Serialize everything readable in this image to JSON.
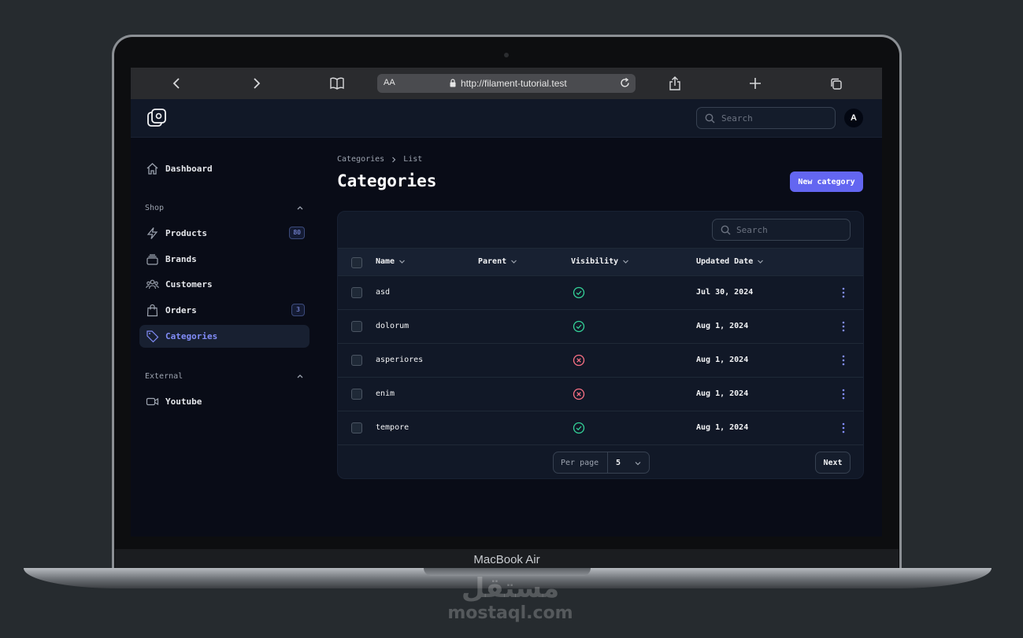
{
  "browser": {
    "aa_label": "AA",
    "url": "http://filament-tutorial.test"
  },
  "topbar": {
    "search_placeholder": "Search",
    "avatar_initial": "A"
  },
  "sidebar": {
    "dashboard": "Dashboard",
    "groups": {
      "shop": "Shop",
      "external": "External"
    },
    "items": [
      {
        "label": "Products",
        "icon": "bolt-icon",
        "badge": "80"
      },
      {
        "label": "Brands",
        "icon": "stack-icon",
        "badge": ""
      },
      {
        "label": "Customers",
        "icon": "users-icon",
        "badge": ""
      },
      {
        "label": "Orders",
        "icon": "shopping-bag-icon",
        "badge": "3"
      },
      {
        "label": "Categories",
        "icon": "tag-icon",
        "badge": "",
        "active": true
      }
    ],
    "youtube": "Youtube"
  },
  "main": {
    "breadcrumb": [
      "Categories",
      "List"
    ],
    "title": "Categories",
    "new_button": "New category",
    "table": {
      "search_placeholder": "Search",
      "columns": [
        "Name",
        "Parent",
        "Visibility",
        "Updated Date"
      ],
      "rows": [
        {
          "name": "asd",
          "parent": "",
          "visible": true,
          "updated": "Jul 30, 2024"
        },
        {
          "name": "dolorum",
          "parent": "",
          "visible": true,
          "updated": "Aug 1, 2024"
        },
        {
          "name": "asperiores",
          "parent": "",
          "visible": false,
          "updated": "Aug 1, 2024"
        },
        {
          "name": "enim",
          "parent": "",
          "visible": false,
          "updated": "Aug 1, 2024"
        },
        {
          "name": "tempore",
          "parent": "",
          "visible": true,
          "updated": "Aug 1, 2024"
        }
      ],
      "per_page_label": "Per page",
      "per_page_value": "5",
      "next_label": "Next"
    }
  },
  "device": {
    "name": "MacBook Air"
  },
  "watermark": {
    "arabic": "مستقل",
    "site": "mostaql.com"
  },
  "colors": {
    "primary": "#6366f1",
    "success": "#34d399",
    "danger": "#fb7185",
    "background": "#090c17",
    "panel": "#111827"
  }
}
